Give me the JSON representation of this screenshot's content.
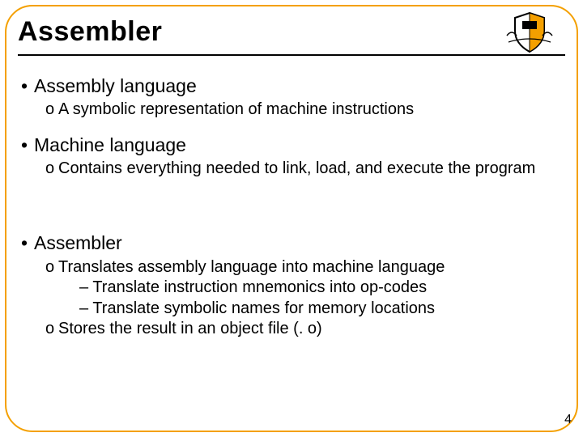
{
  "slide": {
    "title": "Assembler",
    "page_number": "4",
    "bullets": {
      "b1": {
        "label": "Assembly language",
        "sub1": "A symbolic representation of machine instructions"
      },
      "b2": {
        "label": "Machine language",
        "sub1": "Contains everything needed to link, load, and execute the program"
      },
      "b3": {
        "label": "Assembler",
        "sub1": "Translates assembly language into machine language",
        "sub1_d1": "– Translate instruction mnemonics into op-codes",
        "sub1_d2": "– Translate symbolic names for memory locations",
        "sub2": "Stores the result in an object file (. o)"
      }
    },
    "glyphs": {
      "dot": "•",
      "ring": "o"
    }
  }
}
